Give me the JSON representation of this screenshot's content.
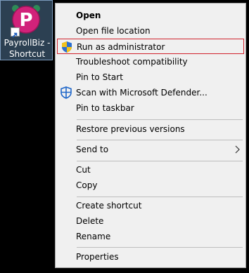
{
  "desktop": {
    "shortcut_label_line1": "PayrollBiz -",
    "shortcut_label_line2": "Shortcut",
    "icon_letter": "P",
    "colors": {
      "background": "#000000",
      "selection": "#50749a"
    }
  },
  "context_menu": {
    "items": [
      {
        "label": "Open",
        "bold": true
      },
      {
        "label": "Open file location"
      },
      {
        "label": "Run as administrator",
        "icon": "uac-shield-icon",
        "highlighted": true
      },
      {
        "label": "Troubleshoot compatibility"
      },
      {
        "label": "Pin to Start"
      },
      {
        "label": "Scan with Microsoft Defender...",
        "icon": "defender-icon"
      },
      {
        "label": "Pin to taskbar"
      },
      {
        "label": "Restore previous versions"
      },
      {
        "label": "Send to",
        "submenu": true,
        "icon": "chevron-right-icon"
      },
      {
        "label": "Cut"
      },
      {
        "label": "Copy"
      },
      {
        "label": "Create shortcut"
      },
      {
        "label": "Delete"
      },
      {
        "label": "Rename"
      },
      {
        "label": "Properties"
      }
    ],
    "colors": {
      "background": "#f0f0f0",
      "highlight_border": "#d0222c"
    }
  }
}
